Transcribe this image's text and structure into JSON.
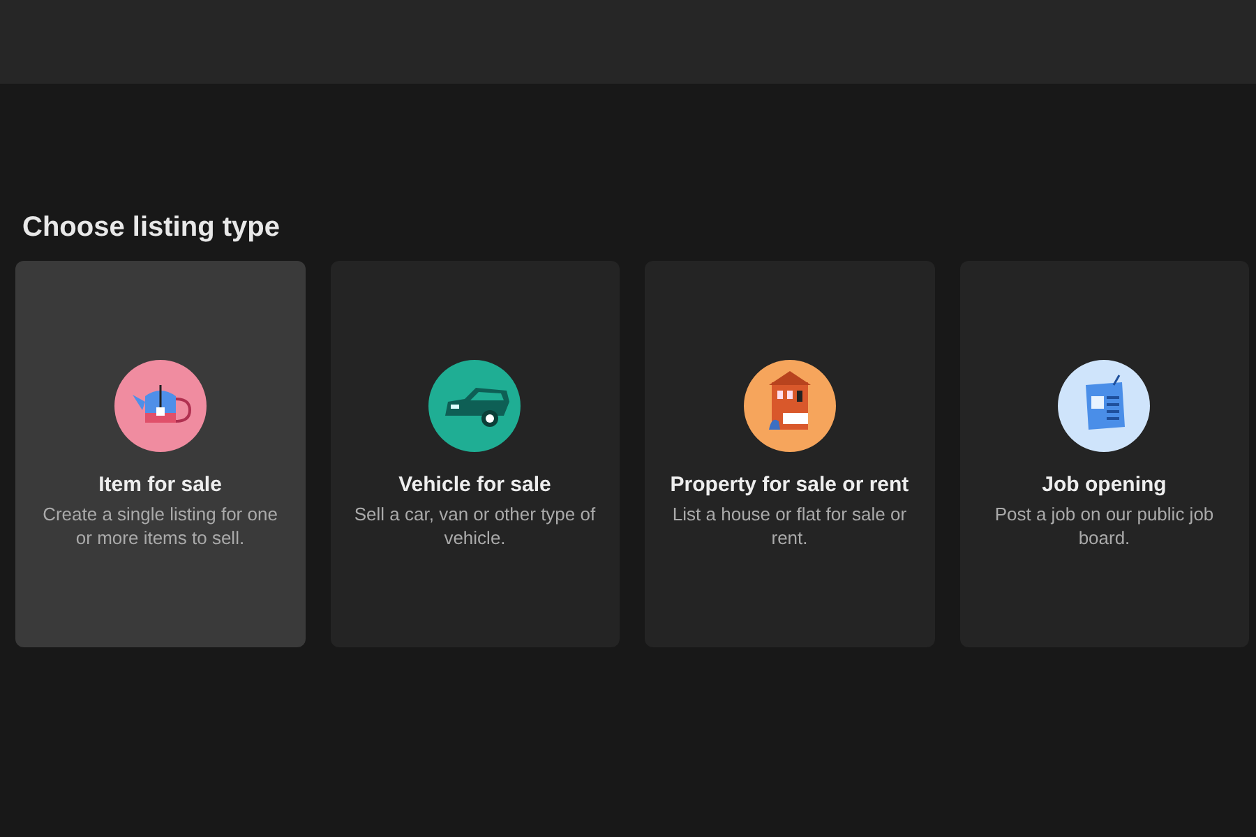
{
  "heading": "Choose listing type",
  "options": [
    {
      "kind": "item",
      "title": "Item for sale",
      "description": "Create a single listing for one or more items to sell.",
      "selected": true
    },
    {
      "kind": "vehicle",
      "title": "Vehicle for sale",
      "description": "Sell a car, van or other type of vehicle.",
      "selected": false
    },
    {
      "kind": "property",
      "title": "Property for sale or rent",
      "description": "List a house or flat for sale or rent.",
      "selected": false
    },
    {
      "kind": "job",
      "title": "Job opening",
      "description": "Post a job on our public job board.",
      "selected": false
    }
  ]
}
